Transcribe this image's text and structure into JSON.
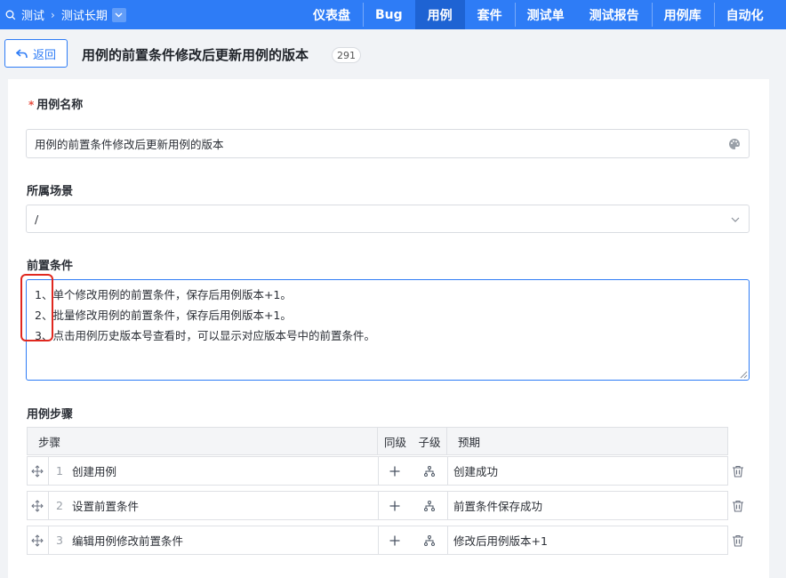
{
  "nav": {
    "project": "测试",
    "iteration": "测试长期",
    "items": [
      {
        "label": "仪表盘"
      },
      {
        "label": "Bug"
      },
      {
        "label": "用例"
      },
      {
        "label": "套件"
      },
      {
        "label": "测试单"
      },
      {
        "label": "测试报告"
      },
      {
        "label": "用例库"
      },
      {
        "label": "自动化"
      }
    ],
    "active": "用例"
  },
  "header": {
    "back_label": "返回",
    "title": "用例的前置条件修改后更新用例的版本",
    "count": "291"
  },
  "form": {
    "name_label": "用例名称",
    "name_value": "用例的前置条件修改后更新用例的版本",
    "scene_label": "所属场景",
    "scene_value": "/",
    "precondition_label": "前置条件",
    "precondition_lines": [
      "1、单个修改用例的前置条件，保存后用例版本+1。",
      "2、批量修改用例的前置条件，保存后用例版本+1。",
      "3、点击用例历史版本号查看时，可以显示对应版本号中的前置条件。"
    ],
    "steps_label": "用例步骤",
    "steps_columns": {
      "step": "步骤",
      "same": "同级",
      "child": "子级",
      "expect": "预期"
    },
    "steps": [
      {
        "no": "1",
        "text": "创建用例",
        "expect": "创建成功"
      },
      {
        "no": "2",
        "text": "设置前置条件",
        "expect": "前置条件保存成功"
      },
      {
        "no": "3",
        "text": "编辑用例修改前置条件",
        "expect": "修改后用例版本+1"
      }
    ]
  },
  "colors": {
    "accent": "#2e7cf6",
    "highlight": "#e0281f"
  }
}
